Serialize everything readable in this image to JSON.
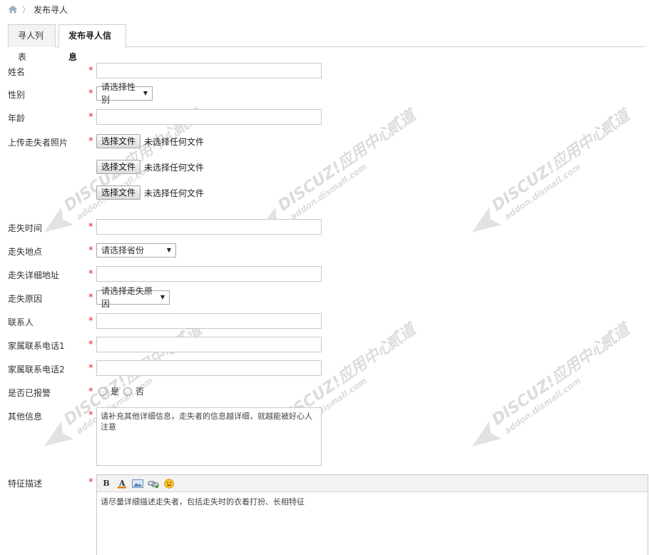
{
  "breadcrumb": {
    "current": "发布寻人"
  },
  "tabs": [
    {
      "label": "寻人列表"
    },
    {
      "label": "发布寻人信息"
    }
  ],
  "form": {
    "name": {
      "label": "姓名",
      "required": "*",
      "value": ""
    },
    "gender": {
      "label": "性别",
      "required": "*",
      "selected": "请选择性别"
    },
    "age": {
      "label": "年龄",
      "required": "*",
      "value": ""
    },
    "photo": {
      "label": "上传走失者照片",
      "required": "*",
      "button": "选择文件",
      "status": "未选择任何文件"
    },
    "lost_time": {
      "label": "走失时间",
      "required": "*",
      "value": ""
    },
    "lost_place": {
      "label": "走失地点",
      "required": "*",
      "selected": "请选择省份"
    },
    "lost_address": {
      "label": "走失详细地址",
      "required": "*",
      "value": ""
    },
    "lost_reason": {
      "label": "走失原因",
      "required": "*",
      "selected": "请选择走失原因"
    },
    "contact": {
      "label": "联系人",
      "required": "*",
      "value": ""
    },
    "phone1": {
      "label": "家属联系电话1",
      "required": "*",
      "value": ""
    },
    "phone2": {
      "label": "家属联系电话2",
      "required": "*",
      "value": ""
    },
    "reported": {
      "label": "是否已报警",
      "required": "*",
      "options": [
        "是",
        "否"
      ]
    },
    "other_info": {
      "label": "其他信息",
      "required": "*",
      "placeholder": "请补充其他详细信息，走失者的信息越详细，就越能被好心人注意"
    },
    "features": {
      "label": "特征描述",
      "required": "*",
      "placeholder": "请尽量详细描述走失者，包括走失时的衣着打扮、长相特征"
    }
  },
  "editor_toolbar": [
    "bold-icon",
    "font-color-icon",
    "image-icon",
    "link-icon",
    "emoji-icon"
  ],
  "watermark": {
    "text1": "DISCUZ!应用中心",
    "text2": "贰道",
    "text3": "addon.dismall.com"
  },
  "colors": {
    "required": "#e02020",
    "border": "#c9c9c9"
  }
}
